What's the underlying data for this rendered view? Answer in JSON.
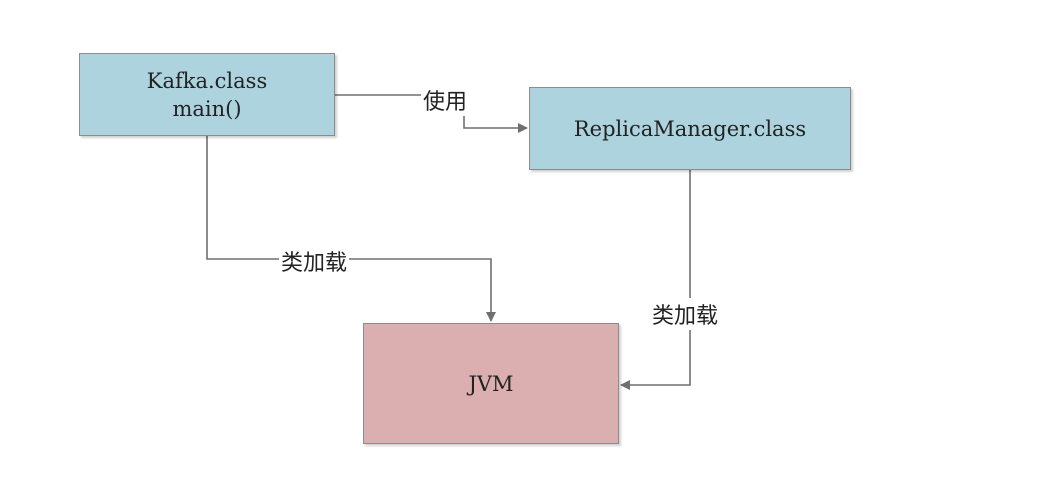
{
  "nodes": {
    "kafka": {
      "line1": "Kafka.class",
      "line2": "main()"
    },
    "replica": {
      "label": "ReplicaManager.class"
    },
    "jvm": {
      "label": "JVM"
    }
  },
  "edges": {
    "use": "使用",
    "load_from_kafka": "类加载",
    "load_from_replica": "类加载"
  },
  "colors": {
    "class_node_fill": "#add3df",
    "jvm_node_fill": "#dbafb0",
    "edge_stroke": "#6f6f6f"
  }
}
